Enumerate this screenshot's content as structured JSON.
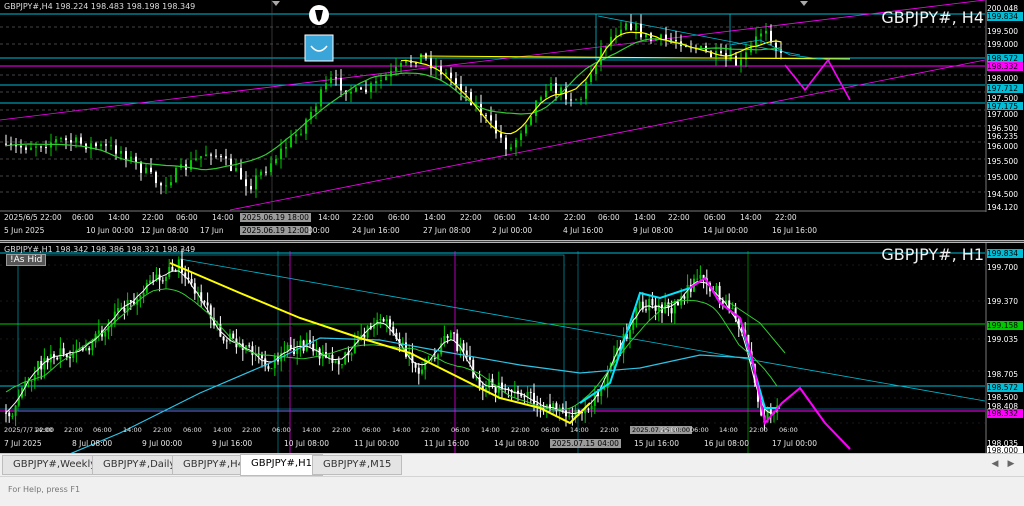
{
  "h4": {
    "info": "GBPJPY#,H4  198.224 198.483 198.198 198.349",
    "symbol": "GBPJPY#, H4",
    "price_labels": [
      {
        "text": "200.048",
        "bg": "#000000",
        "fg": "#ffffff"
      },
      {
        "text": "199.834",
        "bg": "#00bcd4",
        "fg": "#000000"
      },
      {
        "text": "199.500",
        "bg": "#000000",
        "fg": "#ffffff"
      },
      {
        "text": "199.000",
        "bg": "#000000",
        "fg": "#ffffff"
      },
      {
        "text": "198.572",
        "bg": "#00bcd4",
        "fg": "#000000"
      },
      {
        "text": "198.332",
        "bg": "#ff00ff",
        "fg": "#000000"
      },
      {
        "text": "198.000",
        "bg": "#000000",
        "fg": "#ffffff"
      },
      {
        "text": "197.712",
        "bg": "#00bcd4",
        "fg": "#000000"
      },
      {
        "text": "197.500",
        "bg": "#000000",
        "fg": "#ffffff"
      },
      {
        "text": "197.175",
        "bg": "#00bcd4",
        "fg": "#000000"
      },
      {
        "text": "197.000",
        "bg": "#000000",
        "fg": "#ffffff"
      },
      {
        "text": "196.500",
        "bg": "#000000",
        "fg": "#ffffff"
      },
      {
        "text": "196.235",
        "bg": "#000000",
        "fg": "#ffffff"
      },
      {
        "text": "196.000",
        "bg": "#000000",
        "fg": "#ffffff"
      },
      {
        "text": "195.500",
        "bg": "#000000",
        "fg": "#ffffff"
      },
      {
        "text": "195.000",
        "bg": "#000000",
        "fg": "#ffffff"
      },
      {
        "text": "194.500",
        "bg": "#000000",
        "fg": "#ffffff"
      },
      {
        "text": "194.120",
        "bg": "#000000",
        "fg": "#ffffff"
      }
    ],
    "time_labels": [
      "2025/6/5 22:00",
      "06:00",
      "14:00",
      "22:00",
      "06:00",
      "14:00",
      "2025.06.19 18:00",
      "14:00",
      "22:00",
      "06:00",
      "14:00",
      "22:00",
      "06:00",
      "14:00",
      "22:00",
      "06:00",
      "14:00",
      "22:00",
      "06:00",
      "14:00",
      "22:00"
    ],
    "date_labels": [
      "5 Jun 2025",
      "10 Jun 00:00",
      "12 Jun 08:00",
      "17 Jun",
      "2025.06.19 12:00",
      "00:00",
      "24 Jun 16:00",
      "27 Jun 08:00",
      "2 Jul 00:00",
      "4 Jul 16:00",
      "9 Jul 08:00",
      "14 Jul 00:00",
      "16 Jul 16:00"
    ]
  },
  "h1": {
    "info": "GBPJPY#,H1  198.342 198.386 198.321 198.349",
    "symbol": "GBPJPY#, H1",
    "as_hidden": "!As Hid",
    "price_labels": [
      {
        "text": "199.834",
        "bg": "#00bcd4",
        "fg": "#000000"
      },
      {
        "text": "199.700",
        "bg": "#000000",
        "fg": "#ffffff"
      },
      {
        "text": "199.370",
        "bg": "#000000",
        "fg": "#ffffff"
      },
      {
        "text": "199.158",
        "bg": "#00c800",
        "fg": "#000000"
      },
      {
        "text": "199.035",
        "bg": "#000000",
        "fg": "#ffffff"
      },
      {
        "text": "198.705",
        "bg": "#000000",
        "fg": "#ffffff"
      },
      {
        "text": "198.572",
        "bg": "#00bcd4",
        "fg": "#000000"
      },
      {
        "text": "198.500",
        "bg": "#000000",
        "fg": "#ffffff"
      },
      {
        "text": "198.408",
        "bg": "#000000",
        "fg": "#ffffff"
      },
      {
        "text": "198.332",
        "bg": "#ff00ff",
        "fg": "#000000"
      },
      {
        "text": "198.035",
        "bg": "#000000",
        "fg": "#ffffff"
      },
      {
        "text": "198.000",
        "bg": "#ffffff",
        "fg": "#000000"
      }
    ],
    "time_labels": [
      "2025/7/7 22:00",
      "14:00",
      "22:00",
      "06:00",
      "14:00",
      "22:00",
      "06:00",
      "14:00",
      "22:00",
      "06:00",
      "14:00",
      "22:00",
      "06:00",
      "14:00",
      "22:00",
      "06:00",
      "14:00",
      "22:00",
      "06:00",
      "14:00",
      "22:00",
      "2025.07.15 10:00",
      "22:00",
      "06:00",
      "14:00",
      "22:00",
      "06:00"
    ],
    "date_labels": [
      "7 Jul 2025",
      "8 Jul 08:00",
      "9 Jul 00:00",
      "9 Jul 16:00",
      "10 Jul 08:00",
      "11 Jul 00:00",
      "11 Jul 16:00",
      "14 Jul 08:00",
      "2025.07.15 04:00",
      "15 Jul 16:00",
      "16 Jul 08:00",
      "17 Jul 00:00"
    ]
  },
  "tabs": [
    {
      "label": "GBPJPY#,Weekly",
      "active": false
    },
    {
      "label": "GBPJPY#,Daily",
      "active": false
    },
    {
      "label": "GBPJPY#,H4",
      "active": false
    },
    {
      "label": "GBPJPY#,H1",
      "active": true
    },
    {
      "label": "GBPJPY#,M15",
      "active": false
    }
  ],
  "status": {
    "text": "For Help, press F1"
  },
  "icons": {
    "pen": "fountain-pen-icon",
    "smile": "smile-icon",
    "tab_left": "left-triangle-icon",
    "tab_right": "right-triangle-icon"
  },
  "colors": {
    "bull": "#00c800",
    "bear": "#ffffff",
    "magenta": "#ff00ff",
    "cyan": "#00bcd4",
    "yellow": "#ffff00",
    "green_ma": "#32cd32"
  }
}
